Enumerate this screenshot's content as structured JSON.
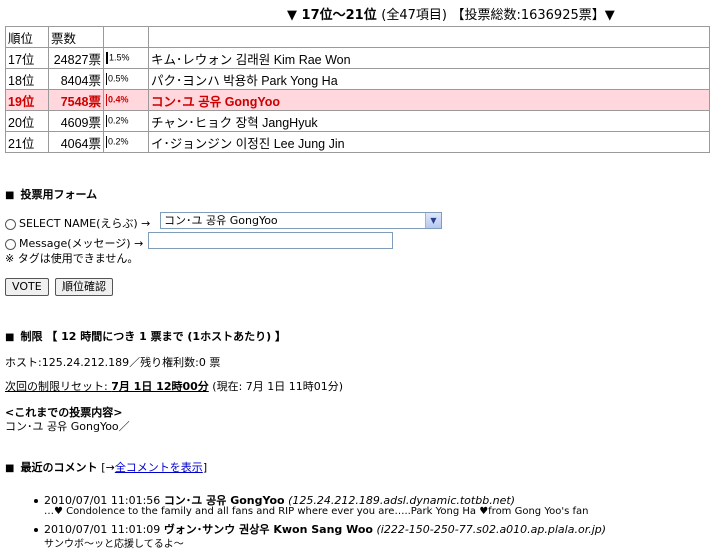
{
  "header": {
    "title_prefix": "▼ 17位〜21位",
    "title_total": "(全47項目)",
    "title_votes": "【投票総数:1636925票】▼"
  },
  "table": {
    "col_rank": "順位",
    "col_votes": "票数",
    "rows": [
      {
        "rank": "17位",
        "votes": "24827票",
        "pct": "1.5%",
        "name": "キム･レウォン 김래원 Kim Rae Won",
        "highlight": false
      },
      {
        "rank": "18位",
        "votes": "8404票",
        "pct": "0.5%",
        "name": "パク･ヨンハ  박용하  Park Yong Ha",
        "highlight": false
      },
      {
        "rank": "19位",
        "votes": "7548票",
        "pct": "0.4%",
        "name": "コン･ユ  공유  GongYoo",
        "highlight": true
      },
      {
        "rank": "20位",
        "votes": "4609票",
        "pct": "0.2%",
        "name": "チャン･ヒョク 장혁  JangHyuk",
        "highlight": false
      },
      {
        "rank": "21位",
        "votes": "4064票",
        "pct": "0.2%",
        "name": "イ･ジョンジン 이정진 Lee Jung Jin",
        "highlight": false
      }
    ]
  },
  "form": {
    "heading": "投票用フォーム",
    "select_label": "SELECT NAME(えらぶ) →",
    "select_value": "コン･ユ 공유 GongYoo",
    "message_label": "Message(メッセージ) →",
    "message_value": "",
    "note": "※ タグは使用できません。",
    "vote_button": "VOTE",
    "rank_button": "順位確認"
  },
  "limit": {
    "heading": "制限",
    "rule": "【 12 時間につき 1 票まで (1ホストあたり) 】",
    "host_line": "ホスト:125.24.212.189／残り権利数:0 票",
    "reset_label": "次回の制限リセット: ",
    "reset_time": "7月 1日 12時00分",
    "reset_now": "(現在: 7月 1日 11時01分)",
    "history_title": "<これまでの投票内容>",
    "history_value": "コン･ユ 공유 GongYoo／"
  },
  "comments": {
    "heading": "最近のコメント",
    "link_prefix": "[→",
    "link_text": "全コメントを表示",
    "link_suffix": "]",
    "items": [
      {
        "time": "2010/07/01 11:01:56",
        "name": "コン･ユ  공유  GongYoo",
        "host": "(125.24.212.189.adsl.dynamic.totbb.net)",
        "text": "…♥ Condolence to the family and all fans and RIP where ever you are…..Park Yong Ha ♥from Gong Yoo's fan"
      },
      {
        "time": "2010/07/01 11:01:09",
        "name": "ヴォン･サンウ  권상우  Kwon Sang Woo",
        "host": "(i222-150-250-77.s02.a010.ap.plala.or.jp)",
        "text": "サンウボ〜ッと応援してるよ〜"
      }
    ]
  }
}
